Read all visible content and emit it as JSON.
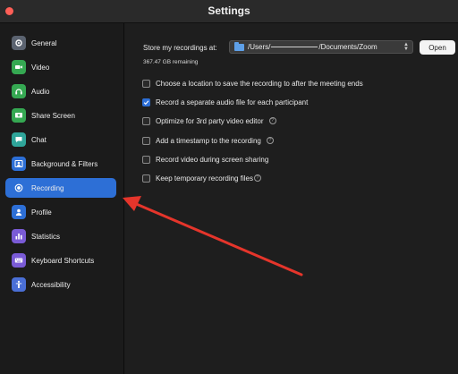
{
  "window": {
    "title": "Settings"
  },
  "sidebar": {
    "items": [
      {
        "label": "General",
        "icon": "gear-icon",
        "color": "#5b6370",
        "active": false
      },
      {
        "label": "Video",
        "icon": "video-camera-icon",
        "color": "#35a852",
        "active": false
      },
      {
        "label": "Audio",
        "icon": "headphones-icon",
        "color": "#35a852",
        "active": false
      },
      {
        "label": "Share Screen",
        "icon": "share-screen-icon",
        "color": "#35a852",
        "active": false
      },
      {
        "label": "Chat",
        "icon": "chat-bubble-icon",
        "color": "#2fa59a",
        "active": false
      },
      {
        "label": "Background & Filters",
        "icon": "person-background-icon",
        "color": "#2d6fd6",
        "active": false
      },
      {
        "label": "Recording",
        "icon": "record-icon",
        "color": "#ffffff",
        "active": true
      },
      {
        "label": "Profile",
        "icon": "profile-icon",
        "color": "#2d6fd6",
        "active": false
      },
      {
        "label": "Statistics",
        "icon": "statistics-icon",
        "color": "#7a5bd6",
        "active": false
      },
      {
        "label": "Keyboard Shortcuts",
        "icon": "keyboard-icon",
        "color": "#7a5bd6",
        "active": false
      },
      {
        "label": "Accessibility",
        "icon": "accessibility-icon",
        "color": "#4a6fd6",
        "active": false
      }
    ]
  },
  "recording": {
    "store_label": "Store my recordings at:",
    "path_prefix": "/Users/",
    "path_suffix": "/Documents/Zoom",
    "open_button": "Open",
    "remaining": "367.47 GB remaining",
    "options": [
      {
        "label": "Choose a location to save the recording to after the meeting ends",
        "checked": false,
        "help": false
      },
      {
        "label": "Record a separate audio file for each participant",
        "checked": true,
        "help": false
      },
      {
        "label": "Optimize for 3rd party video editor",
        "checked": false,
        "help": true
      },
      {
        "label": "Add a timestamp to the recording",
        "checked": false,
        "help": true
      },
      {
        "label": "Record video during screen sharing",
        "checked": false,
        "help": false
      },
      {
        "label": "Keep temporary recording files",
        "checked": false,
        "help": true
      }
    ]
  },
  "colors": {
    "accent": "#2d6fd6",
    "annotation_arrow": "#e5352b"
  }
}
